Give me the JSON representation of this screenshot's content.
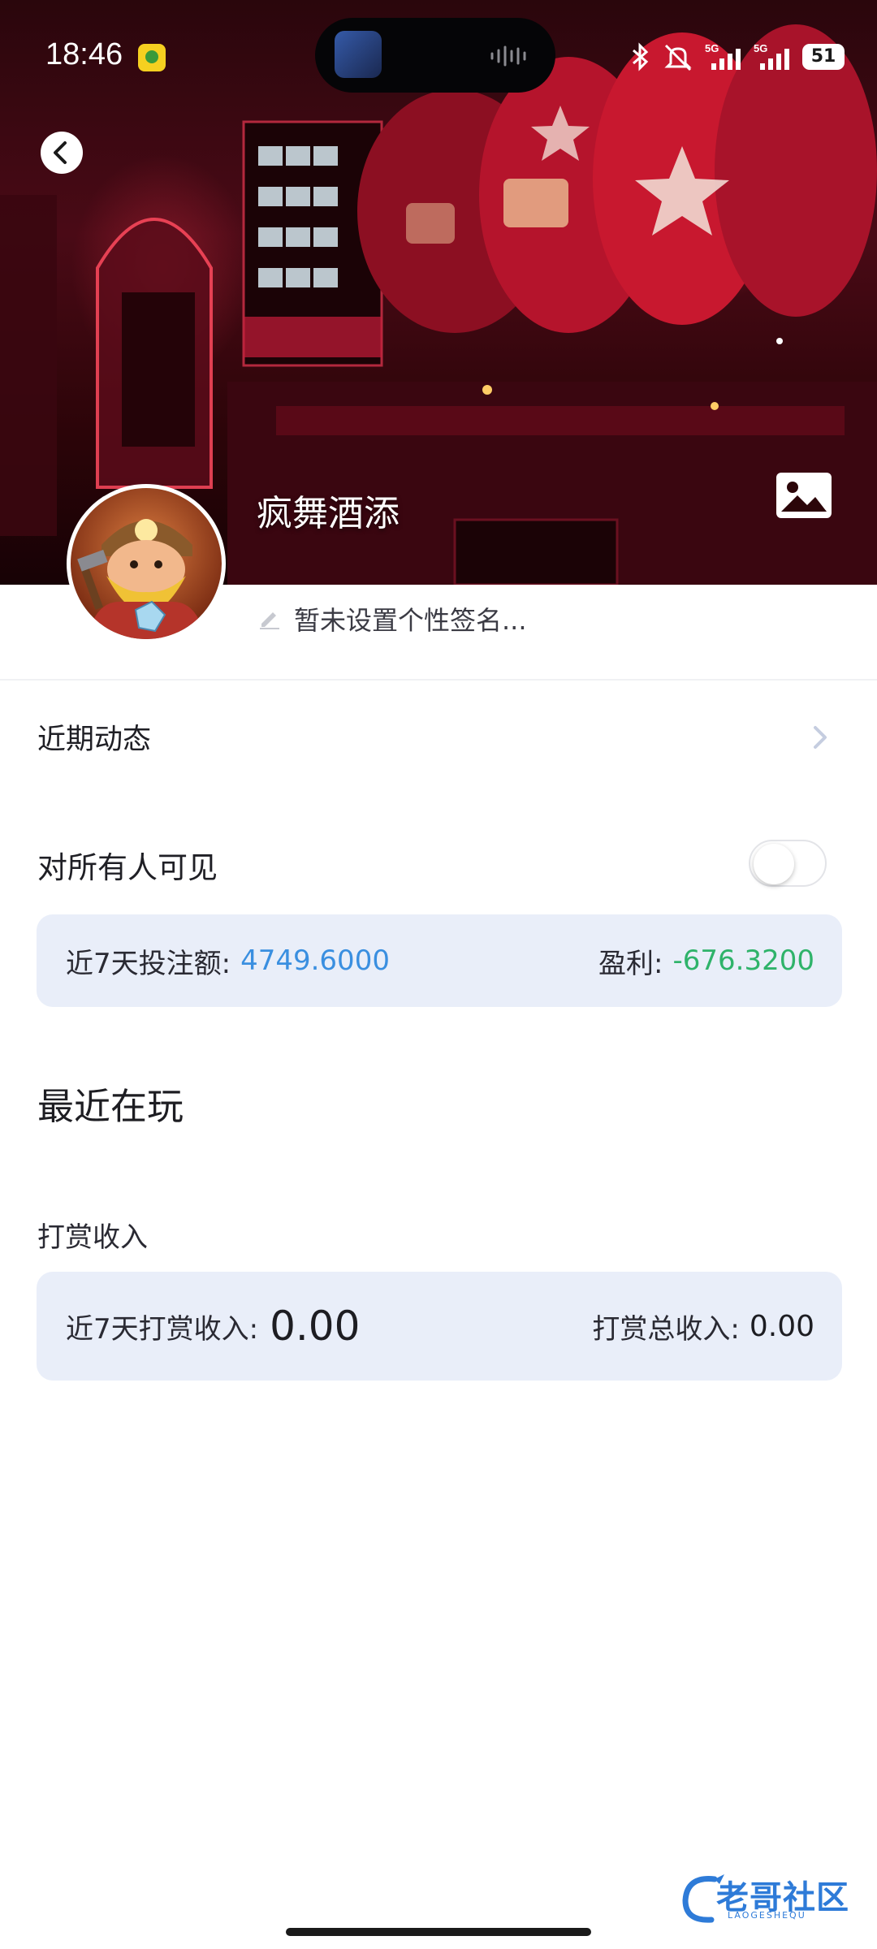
{
  "status_bar": {
    "time": "18:46",
    "signal_1": "5G",
    "signal_2": "5G",
    "battery": "51"
  },
  "profile": {
    "username": "疯舞酒添",
    "signature_placeholder": "暂未设置个性签名..."
  },
  "rows": {
    "recent_activity": "近期动态",
    "visible_to_all": "对所有人可见",
    "visible_toggle_on": false
  },
  "betting": {
    "bet_label": "近7天投注额:",
    "bet_value": "4749.6000",
    "profit_label": "盈利:",
    "profit_value": "-676.3200"
  },
  "recently_playing": {
    "title": "最近在玩"
  },
  "rewards": {
    "title": "打赏收入",
    "week_label": "近7天打赏收入:",
    "week_value": "0.00",
    "total_label": "打赏总收入:",
    "total_value": "0.00"
  },
  "watermark": {
    "text": "老哥社区",
    "sub": "LAOGESHEQU"
  },
  "colors": {
    "accent_blue": "#3a8fe0",
    "profit_green": "#2fb36a",
    "card_bg": "#e9eef9"
  },
  "icons": [
    "back-arrow-icon",
    "image-icon",
    "pencil-icon",
    "chevron-right-icon",
    "bluetooth-icon",
    "mute-icon",
    "signal-icon",
    "battery-icon"
  ]
}
